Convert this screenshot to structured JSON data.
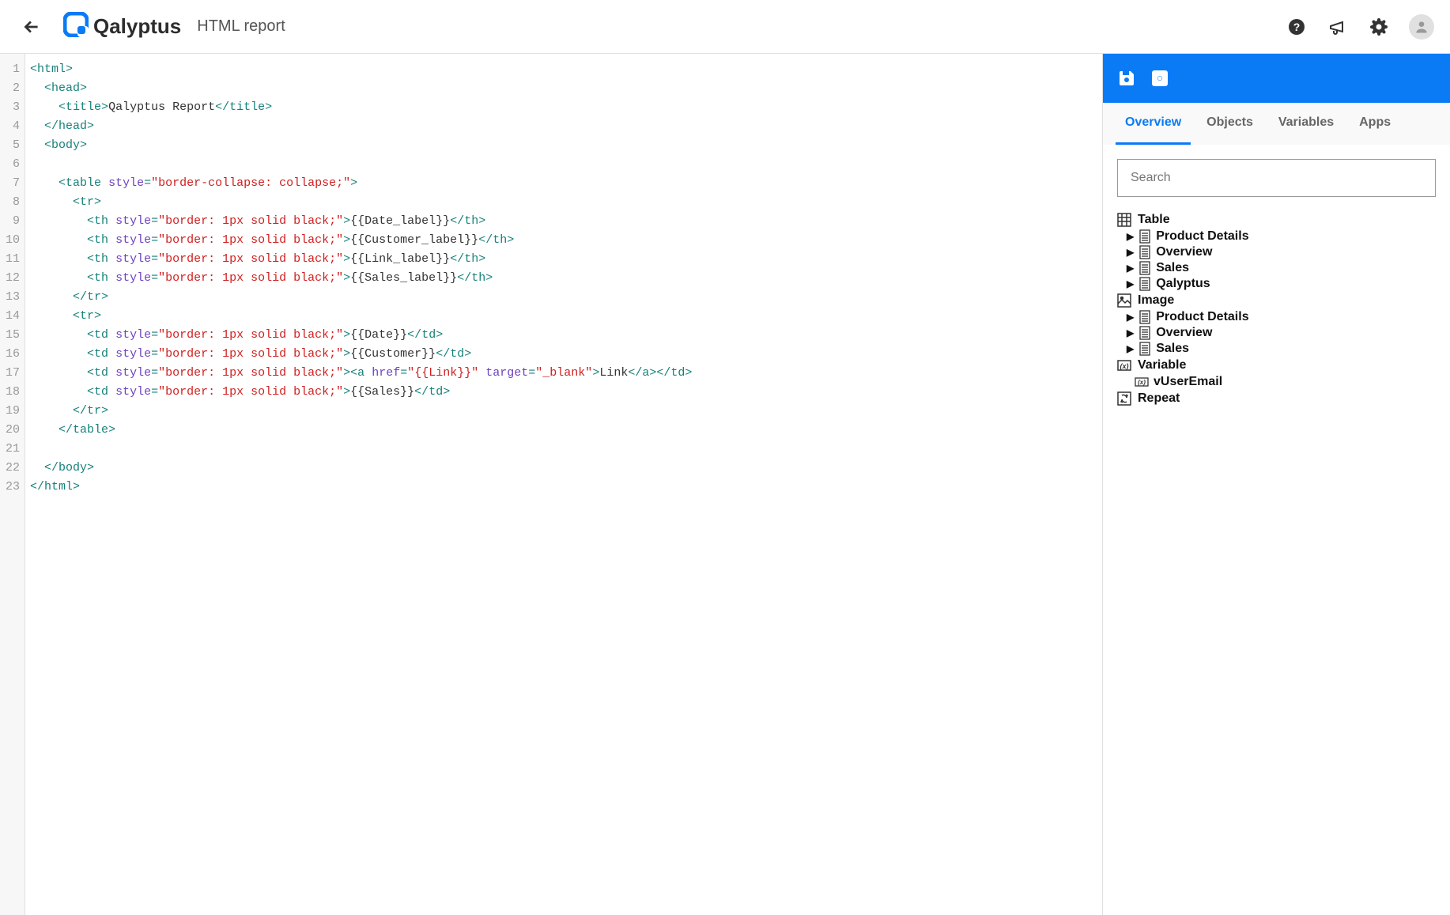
{
  "header": {
    "brand": "Qalyptus",
    "page_title": "HTML report"
  },
  "editor": {
    "total_lines": 23,
    "lines": [
      [
        {
          "t": "tag",
          "v": "<html>"
        }
      ],
      [
        {
          "t": "indent",
          "v": "  "
        },
        {
          "t": "tag",
          "v": "<head>"
        }
      ],
      [
        {
          "t": "indent",
          "v": "    "
        },
        {
          "t": "tag",
          "v": "<title>"
        },
        {
          "t": "txt",
          "v": "Qalyptus Report"
        },
        {
          "t": "tag",
          "v": "</title>"
        }
      ],
      [
        {
          "t": "indent",
          "v": "  "
        },
        {
          "t": "tag",
          "v": "</head>"
        }
      ],
      [
        {
          "t": "indent",
          "v": "  "
        },
        {
          "t": "tag",
          "v": "<body>"
        }
      ],
      [],
      [
        {
          "t": "indent",
          "v": "    "
        },
        {
          "t": "tagopen",
          "name": "table",
          "attrs": [
            {
              "n": "style",
              "v": "border-collapse: collapse;"
            }
          ]
        }
      ],
      [
        {
          "t": "indent",
          "v": "      "
        },
        {
          "t": "tag",
          "v": "<tr>"
        }
      ],
      [
        {
          "t": "indent",
          "v": "        "
        },
        {
          "t": "tagopen",
          "name": "th",
          "attrs": [
            {
              "n": "style",
              "v": "border: 1px solid black;"
            }
          ]
        },
        {
          "t": "txt",
          "v": "{{Date_label}}"
        },
        {
          "t": "tag",
          "v": "</th>"
        }
      ],
      [
        {
          "t": "indent",
          "v": "        "
        },
        {
          "t": "tagopen",
          "name": "th",
          "attrs": [
            {
              "n": "style",
              "v": "border: 1px solid black;"
            }
          ]
        },
        {
          "t": "txt",
          "v": "{{Customer_label}}"
        },
        {
          "t": "tag",
          "v": "</th>"
        }
      ],
      [
        {
          "t": "indent",
          "v": "        "
        },
        {
          "t": "tagopen",
          "name": "th",
          "attrs": [
            {
              "n": "style",
              "v": "border: 1px solid black;"
            }
          ]
        },
        {
          "t": "txt",
          "v": "{{Link_label}}"
        },
        {
          "t": "tag",
          "v": "</th>"
        }
      ],
      [
        {
          "t": "indent",
          "v": "        "
        },
        {
          "t": "tagopen",
          "name": "th",
          "attrs": [
            {
              "n": "style",
              "v": "border: 1px solid black;"
            }
          ]
        },
        {
          "t": "txt",
          "v": "{{Sales_label}}"
        },
        {
          "t": "tag",
          "v": "</th>"
        }
      ],
      [
        {
          "t": "indent",
          "v": "      "
        },
        {
          "t": "tag",
          "v": "</tr>"
        }
      ],
      [
        {
          "t": "indent",
          "v": "      "
        },
        {
          "t": "tag",
          "v": "<tr>"
        }
      ],
      [
        {
          "t": "indent",
          "v": "        "
        },
        {
          "t": "tagopen",
          "name": "td",
          "attrs": [
            {
              "n": "style",
              "v": "border: 1px solid black;"
            }
          ]
        },
        {
          "t": "txt",
          "v": "{{Date}}"
        },
        {
          "t": "tag",
          "v": "</td>"
        }
      ],
      [
        {
          "t": "indent",
          "v": "        "
        },
        {
          "t": "tagopen",
          "name": "td",
          "attrs": [
            {
              "n": "style",
              "v": "border: 1px solid black;"
            }
          ]
        },
        {
          "t": "txt",
          "v": "{{Customer}}"
        },
        {
          "t": "tag",
          "v": "</td>"
        }
      ],
      [
        {
          "t": "indent",
          "v": "        "
        },
        {
          "t": "tagopen",
          "name": "td",
          "attrs": [
            {
              "n": "style",
              "v": "border: 1px solid black;"
            }
          ]
        },
        {
          "t": "tagopen",
          "name": "a",
          "attrs": [
            {
              "n": "href",
              "v": "{{Link}}"
            },
            {
              "n": "target",
              "v": "_blank"
            }
          ]
        },
        {
          "t": "txt",
          "v": "Link"
        },
        {
          "t": "tag",
          "v": "</a>"
        },
        {
          "t": "tag",
          "v": "</td>"
        }
      ],
      [
        {
          "t": "indent",
          "v": "        "
        },
        {
          "t": "tagopen",
          "name": "td",
          "attrs": [
            {
              "n": "style",
              "v": "border: 1px solid black;"
            }
          ]
        },
        {
          "t": "txt",
          "v": "{{Sales}}"
        },
        {
          "t": "tag",
          "v": "</td>"
        }
      ],
      [
        {
          "t": "indent",
          "v": "      "
        },
        {
          "t": "tag",
          "v": "</tr>"
        }
      ],
      [
        {
          "t": "indent",
          "v": "    "
        },
        {
          "t": "tag",
          "v": "</table>"
        }
      ],
      [],
      [
        {
          "t": "indent",
          "v": "  "
        },
        {
          "t": "tag",
          "v": "</body>"
        }
      ],
      [
        {
          "t": "tag",
          "v": "</html>"
        }
      ]
    ]
  },
  "sidebar": {
    "tabs": {
      "overview": "Overview",
      "objects": "Objects",
      "variables": "Variables",
      "apps": "Apps"
    },
    "active_tab": "overview",
    "search_placeholder": "Search",
    "tree": {
      "table": {
        "label": "Table",
        "items": [
          "Product Details",
          "Overview",
          "Sales",
          "Qalyptus"
        ]
      },
      "image": {
        "label": "Image",
        "items": [
          "Product Details",
          "Overview",
          "Sales"
        ]
      },
      "variable": {
        "label": "Variable",
        "items": [
          "vUserEmail"
        ]
      },
      "repeat": {
        "label": "Repeat"
      }
    }
  }
}
